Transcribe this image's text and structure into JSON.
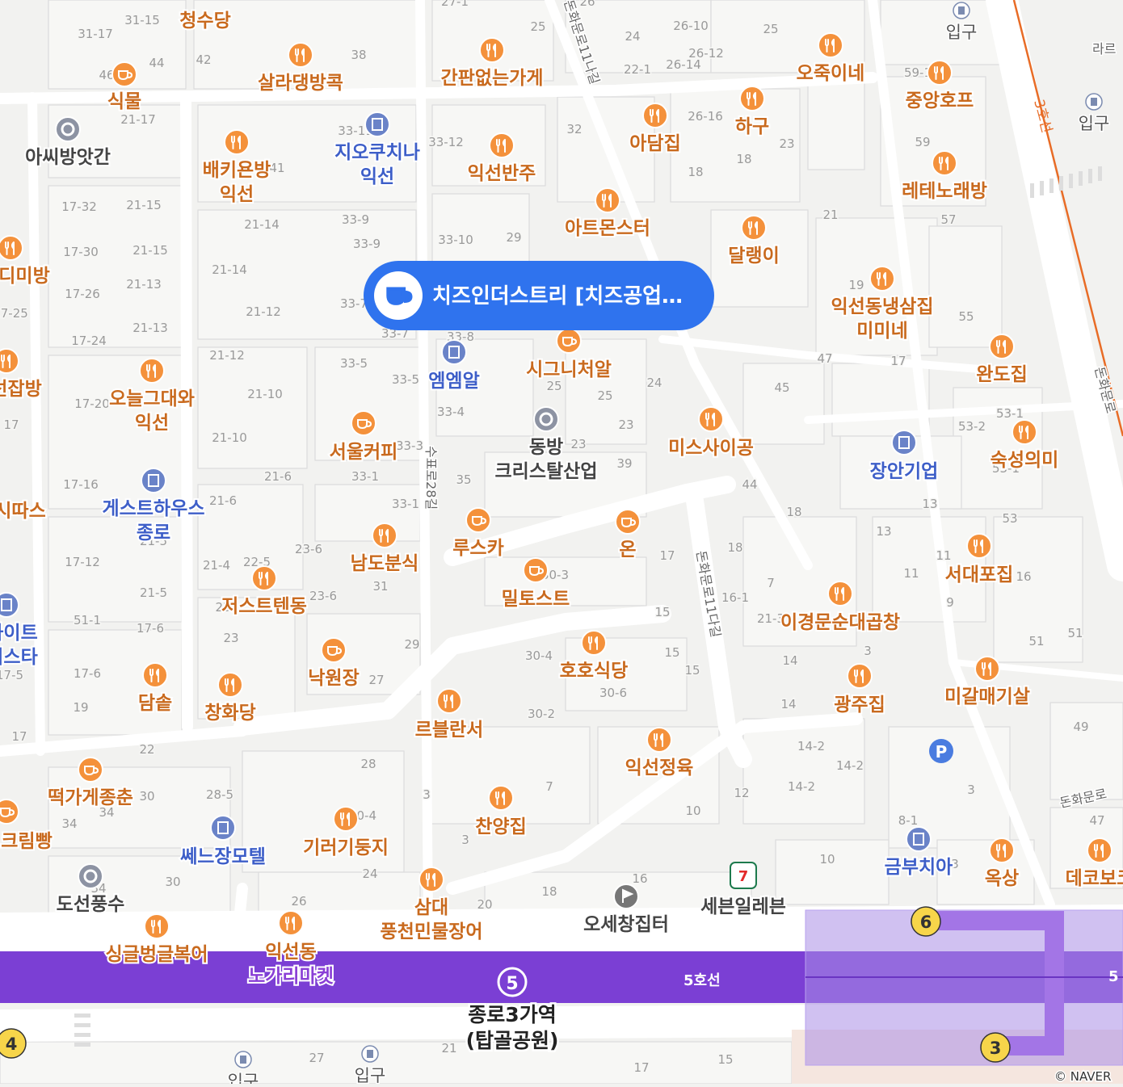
{
  "map": {
    "credit": "© NAVER",
    "subway_line_label": "5호선",
    "line3_label": "3호선",
    "station": {
      "line_number": "5",
      "name_line1": "종로3가역",
      "name_line2": "(탑골공원)"
    },
    "exits": [
      "6",
      "3",
      "4"
    ],
    "selected_place": {
      "label": "치즈인더스트리 [치즈공업…",
      "icon": "cafe-cup-icon",
      "color": "#2f73ee"
    },
    "colors": {
      "food": "#f4913b",
      "cafe": "#f4913b",
      "building": "#6a83c8",
      "line5": "#7b3fd4",
      "line3": "#e86c26",
      "exit_yellow": "#f7d54a",
      "parking": "#4a7ce0"
    }
  },
  "pois": [
    {
      "name": "청수당",
      "icon": "cafe-icon"
    },
    {
      "name": "식물",
      "icon": "cafe-icon"
    },
    {
      "name": "살라댕방콕",
      "icon": "restaurant-icon"
    },
    {
      "name": "간판없는가게",
      "icon": "restaurant-icon"
    },
    {
      "name": "오죽이네",
      "icon": "restaurant-icon"
    },
    {
      "name": "중앙호프",
      "icon": "restaurant-icon"
    },
    {
      "name": "아담집",
      "icon": "restaurant-icon"
    },
    {
      "name": "하구",
      "icon": "restaurant-icon"
    },
    {
      "name": "아씨방앗간",
      "icon": "landmark-icon"
    },
    {
      "name": "배키욘방\n익선",
      "icon": "restaurant-icon"
    },
    {
      "name": "지오쿠치나\n익선",
      "icon": "building-icon"
    },
    {
      "name": "익선반주",
      "icon": "restaurant-icon"
    },
    {
      "name": "레테노래방",
      "icon": "restaurant-icon"
    },
    {
      "name": "아트몬스터",
      "icon": "restaurant-icon"
    },
    {
      "name": "달랭이",
      "icon": "restaurant-icon"
    },
    {
      "name": "디미방",
      "icon": "restaurant-icon"
    },
    {
      "name": "익선동냉삼집\n미미네",
      "icon": "restaurant-icon"
    },
    {
      "name": "엠엠알",
      "icon": "shop-icon"
    },
    {
      "name": "시그니처알",
      "icon": "cafe-icon"
    },
    {
      "name": "완도집",
      "icon": "restaurant-icon"
    },
    {
      "name": "선잡방",
      "icon": "restaurant-icon"
    },
    {
      "name": "오늘그대와\n익선",
      "icon": "restaurant-icon"
    },
    {
      "name": "동방\n크리스탈산업",
      "icon": "landmark-icon"
    },
    {
      "name": "미스사이공",
      "icon": "restaurant-icon"
    },
    {
      "name": "서울커피",
      "icon": "cafe-icon"
    },
    {
      "name": "장안기업",
      "icon": "building-icon"
    },
    {
      "name": "숙성의미",
      "icon": "restaurant-icon"
    },
    {
      "name": "게스트하우스\n종로",
      "icon": "lodging-icon"
    },
    {
      "name": "시따스",
      "icon": "cafe-icon"
    },
    {
      "name": "루스카",
      "icon": "cafe-icon"
    },
    {
      "name": "온",
      "icon": "cafe-icon"
    },
    {
      "name": "남도분식",
      "icon": "restaurant-icon"
    },
    {
      "name": "서대포집",
      "icon": "restaurant-icon"
    },
    {
      "name": "밀토스트",
      "icon": "cafe-icon"
    },
    {
      "name": "저스트텐동",
      "icon": "restaurant-icon"
    },
    {
      "name": "이경문순대곱창",
      "icon": "restaurant-icon"
    },
    {
      "name": "화이트\n비스타",
      "icon": "lodging-icon"
    },
    {
      "name": "낙원장",
      "icon": "cafe-icon"
    },
    {
      "name": "호호식당",
      "icon": "restaurant-icon"
    },
    {
      "name": "담솥",
      "icon": "restaurant-icon"
    },
    {
      "name": "창화당",
      "icon": "restaurant-icon"
    },
    {
      "name": "광주집",
      "icon": "restaurant-icon"
    },
    {
      "name": "미갈매기살",
      "icon": "restaurant-icon"
    },
    {
      "name": "르블란서",
      "icon": "restaurant-icon"
    },
    {
      "name": "익선정육",
      "icon": "restaurant-icon"
    },
    {
      "name": "떡가게종춘",
      "icon": "cafe-icon"
    },
    {
      "name": "찬양집",
      "icon": "restaurant-icon"
    },
    {
      "name": "크림빵",
      "icon": "cafe-icon"
    },
    {
      "name": "쎄느장모텔",
      "icon": "lodging-icon"
    },
    {
      "name": "기러기둥지",
      "icon": "restaurant-icon"
    },
    {
      "name": "금부치아",
      "icon": "building-icon"
    },
    {
      "name": "옥상",
      "icon": "restaurant-icon"
    },
    {
      "name": "데코보코",
      "icon": "restaurant-icon"
    },
    {
      "name": "도선풍수",
      "icon": "landmark-icon"
    },
    {
      "name": "삼대\n풍천민물장어",
      "icon": "restaurant-icon"
    },
    {
      "name": "오세창집터",
      "icon": "flag-icon"
    },
    {
      "name": "세븐일레븐",
      "icon": "convenience-store-icon"
    },
    {
      "name": "싱글벙글복어",
      "icon": "restaurant-icon"
    },
    {
      "name": "익선동\n노가리마켓",
      "icon": "restaurant-icon"
    }
  ],
  "entrances": [
    "입구",
    "입구",
    "입구",
    "입구"
  ],
  "road_names": [
    "돈화문로11나길",
    "수표로28길",
    "돈화문로11다길",
    "돈화문로",
    "돈화문로",
    "라르"
  ],
  "parcel_numbers": [
    "31-15",
    "31-17",
    "44",
    "42",
    "38",
    "27-1",
    "25",
    "26",
    "26-10",
    "24",
    "26-12",
    "25",
    "22-1",
    "26-14",
    "46",
    "21-17",
    "33-11",
    "32",
    "26-16",
    "18",
    "23",
    "59-1",
    "59",
    "57",
    "33-12",
    "41",
    "17-32",
    "21-15",
    "21-14",
    "33-9",
    "33-10",
    "29",
    "21",
    "18",
    "17-30",
    "21-15",
    "33-9",
    "21-14",
    "19",
    "17-26",
    "21-13",
    "21-12",
    "33-7",
    "33-8",
    "55",
    "17-25",
    "17-24",
    "21-13",
    "33-7",
    "47",
    "17",
    "21-12",
    "33-5",
    "33-5",
    "25",
    "24",
    "45",
    "17-20",
    "21-10",
    "33-4",
    "25",
    "53-2",
    "53-1",
    "17",
    "21-10",
    "33-3",
    "23",
    "23",
    "39",
    "35",
    "33-1",
    "21-6",
    "17-16",
    "21-6",
    "44",
    "18",
    "53",
    "53-1",
    "33-1",
    "13",
    "21-5",
    "23-6",
    "22-5",
    "31",
    "17",
    "18",
    "13",
    "11",
    "11",
    "21-4",
    "30-3",
    "17-12",
    "23-6",
    "21-5",
    "23",
    "15",
    "16-1",
    "7",
    "9",
    "21-3",
    "16",
    "51-1",
    "17-6",
    "29",
    "30-4",
    "15",
    "14",
    "51",
    "51",
    "23",
    "15",
    "27",
    "30-6",
    "3",
    "17-5",
    "17-6",
    "19",
    "30-2",
    "14",
    "49",
    "17",
    "22",
    "28",
    "14-2",
    "14-2",
    "3",
    "30",
    "28-5",
    "3",
    "7",
    "12",
    "14-2",
    "47",
    "34",
    "34",
    "30-4",
    "10",
    "8-1",
    "34",
    "3",
    "30",
    "26",
    "24",
    "20",
    "18",
    "16",
    "10",
    "3",
    "27",
    "21",
    "17",
    "15"
  ],
  "cafe_marker_label": "cafe"
}
